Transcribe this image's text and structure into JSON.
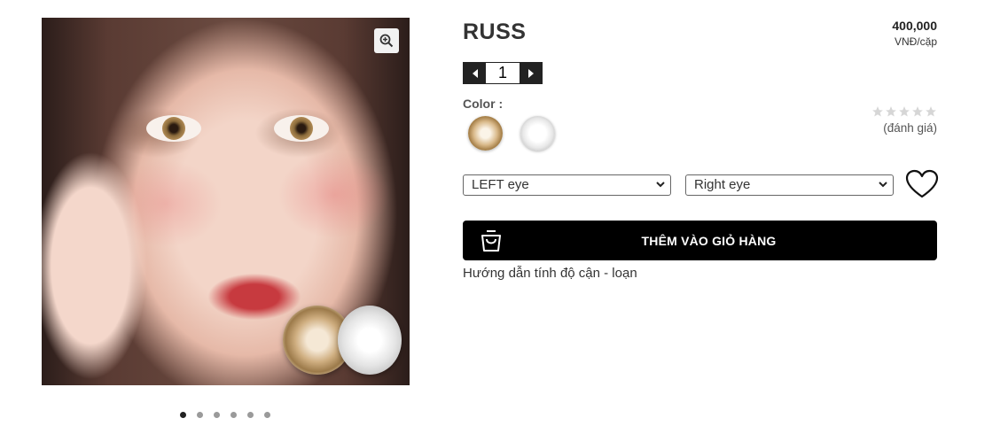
{
  "product": {
    "name": "RUSS",
    "price": "400,000",
    "price_unit": "VNĐ/cặp",
    "quantity": "1",
    "color_label": "Color :",
    "colors": [
      "brown",
      "gray"
    ],
    "rating_count_text": "(đánh giá)",
    "rating_stars": 0,
    "left_eye_select": "LEFT eye",
    "right_eye_select": "Right eye",
    "add_to_cart_label": "THÊM VÀO GIỎ HÀNG",
    "guide_link": "Hướng dẫn tính độ cận - loạn"
  },
  "gallery": {
    "slide_count": 6,
    "active_slide": 1
  },
  "colors": {
    "button_bg": "#000000",
    "star_empty": "#d6d6d6"
  }
}
